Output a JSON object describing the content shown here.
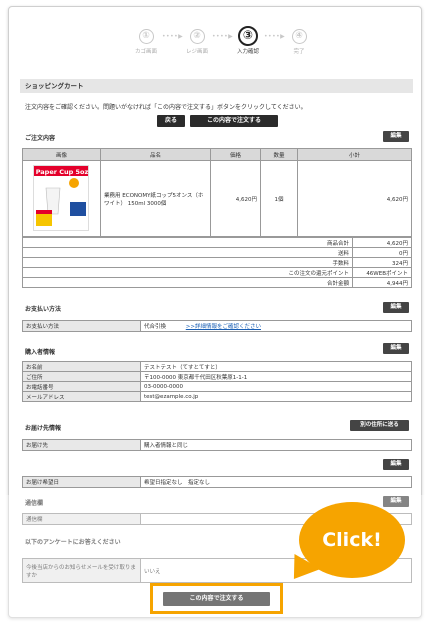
{
  "steps": [
    {
      "num": "①",
      "label": "カゴ画面"
    },
    {
      "num": "②",
      "label": "レジ画面"
    },
    {
      "num": "③",
      "label": "入力確認"
    },
    {
      "num": "④",
      "label": "完了"
    }
  ],
  "step_arrow": "••••▶",
  "cart": {
    "title": "ショッピングカート",
    "instruction": "注文内容をご確認ください。問題いがなければ「この内容で注文する」ボタンをクリックしてください。",
    "back_label": "戻る",
    "order_label": "この内容で注文する"
  },
  "order": {
    "heading": "ご注文内容",
    "edit_label": "編集",
    "columns": [
      "画像",
      "品名",
      "価格",
      "数量",
      "小計"
    ],
    "item": {
      "image_title": "Paper Cup 5oz",
      "name": "業務用 ECONOMY紙コップ5オンス（ホワイト） 150ml 3000個",
      "price": "4,620円",
      "qty": "1個",
      "subtotal": "4,620円"
    },
    "summary": [
      {
        "label": "商品合計",
        "value": "4,620円"
      },
      {
        "label": "送料",
        "value": "0円"
      },
      {
        "label": "手数料",
        "value": "324円"
      },
      {
        "label": "この注文の還元ポイント",
        "value": "46WEBポイント"
      },
      {
        "label": "合計金額",
        "value": "4,944円"
      }
    ]
  },
  "payment": {
    "heading": "お支払い方法",
    "edit_label": "編集",
    "label": "お支払い方法",
    "value": "代合引換",
    "link": ">>詳細情報をご確認ください"
  },
  "buyer": {
    "heading": "購入者情報",
    "edit_label": "編集",
    "rows": [
      {
        "label": "お名前",
        "value": "テストテスト（てすとてすと）"
      },
      {
        "label": "ご住所",
        "value": "〒100-0000 東京都千代田区秋葉原1-1-1"
      },
      {
        "label": "お電話番号",
        "value": "03-0000-0000"
      },
      {
        "label": "メールアドレス",
        "value": "test@ezample.co.jp"
      }
    ]
  },
  "delivery": {
    "heading": "お届け先情報",
    "send_other_label": "別の住所に送る",
    "dest_label": "お届け先",
    "dest_value": "購入者情報と同じ",
    "edit_label": "編集",
    "date_label": "お届け希望日",
    "date_value": "希望日指定なし　指定なし"
  },
  "comm": {
    "heading": "通信欄",
    "edit_label": "編集",
    "label": "通信欄",
    "value": ""
  },
  "survey": {
    "heading": "以下のアンケートにお答えください",
    "question": "今後当店からのお知らせメールを受け取りますか",
    "answer": "いいえ"
  },
  "bottom_order_label": "この内容で注文する",
  "callout": "Click!",
  "colors": {
    "accent": "#f6a400",
    "button": "#2b2b2b",
    "bar": "#e6e6e6"
  }
}
